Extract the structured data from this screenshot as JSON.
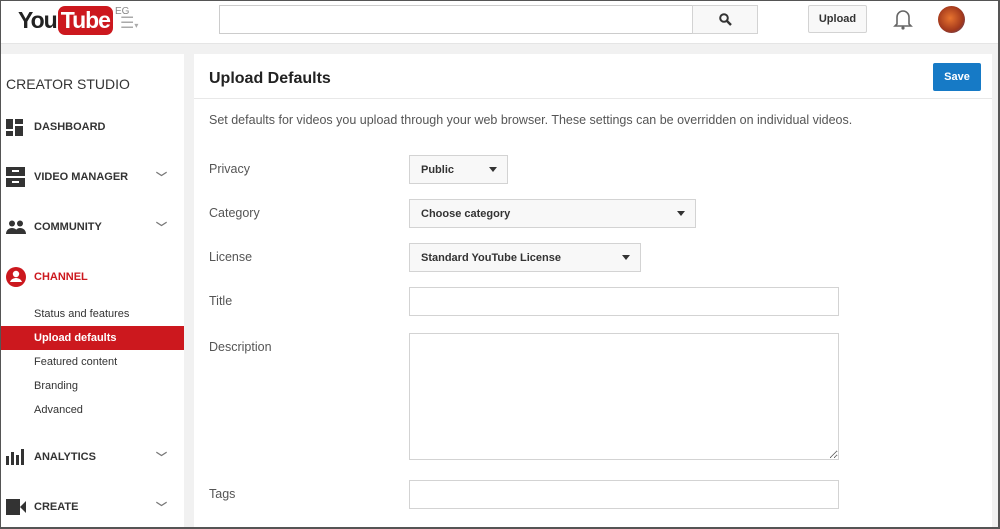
{
  "header": {
    "logo_you": "You",
    "logo_tube": "Tube",
    "country": "EG",
    "search_placeholder": "",
    "upload_label": "Upload"
  },
  "sidebar": {
    "title": "CREATOR STUDIO",
    "items": [
      {
        "label": "DASHBOARD",
        "icon": "dashboard-icon"
      },
      {
        "label": "VIDEO MANAGER",
        "icon": "video-manager-icon"
      },
      {
        "label": "COMMUNITY",
        "icon": "community-icon"
      },
      {
        "label": "CHANNEL",
        "icon": "channel-icon"
      },
      {
        "label": "ANALYTICS",
        "icon": "analytics-icon"
      },
      {
        "label": "CREATE",
        "icon": "create-icon"
      }
    ],
    "channel_sub": [
      "Status and features",
      "Upload defaults",
      "Featured content",
      "Branding",
      "Advanced"
    ]
  },
  "main": {
    "title": "Upload Defaults",
    "save_label": "Save",
    "description": "Set defaults for videos you upload through your web browser. These settings can be overridden on individual videos.",
    "fields": {
      "privacy": {
        "label": "Privacy",
        "value": "Public"
      },
      "category": {
        "label": "Category",
        "value": "Choose category"
      },
      "license": {
        "label": "License",
        "value": "Standard YouTube License"
      },
      "title": {
        "label": "Title",
        "value": ""
      },
      "description": {
        "label": "Description",
        "value": ""
      },
      "tags": {
        "label": "Tags",
        "value": ""
      }
    }
  },
  "colors": {
    "brand_red": "#cc181e",
    "save_blue": "#167ac6"
  }
}
